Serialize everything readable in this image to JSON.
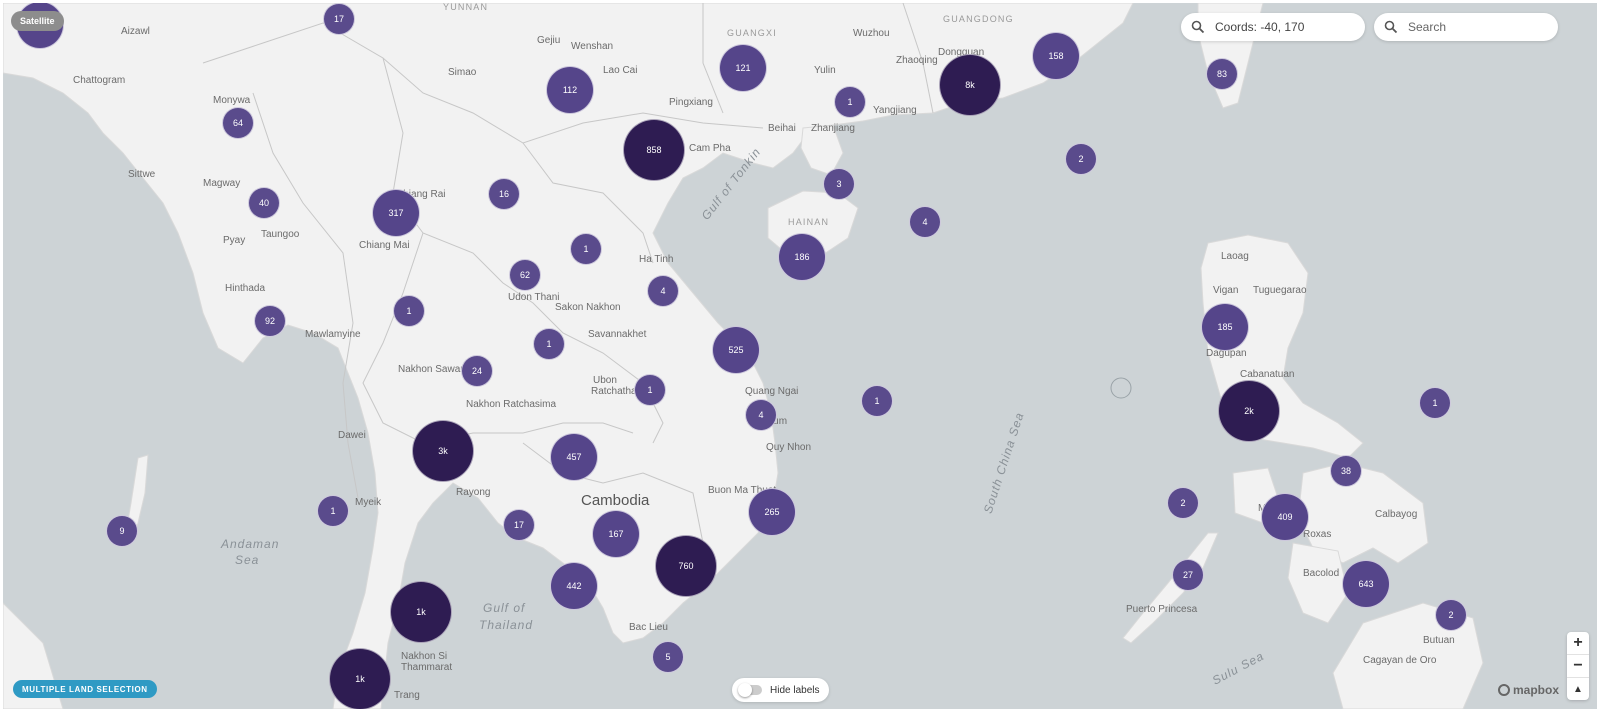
{
  "controls": {
    "satellite_label": "Satellite",
    "coords_value": "Coords: -40, 170",
    "search_placeholder": "Search",
    "multiple_land_label": "MULTIPLE LAND SELECTION",
    "hide_labels_label": "Hide labels",
    "zoom_in": "+",
    "zoom_out": "−",
    "compass": "▲",
    "attribution": "mapbox",
    "search_icon": "magnifier-icon"
  },
  "colors": {
    "water": "#cdd3d6",
    "land": "#f2f2f2",
    "cluster_small": "#5a4b8c",
    "cluster_big": "#2e1c52",
    "accent_button": "#2f9ac4"
  },
  "clusters": [
    {
      "label": "17"
    },
    {
      "label": "64"
    },
    {
      "label": "40"
    },
    {
      "label": "92"
    },
    {
      "label": "9"
    },
    {
      "label": "1"
    },
    {
      "label": "1"
    },
    {
      "label": "112"
    },
    {
      "label": "317"
    },
    {
      "label": "16"
    },
    {
      "label": "1"
    },
    {
      "label": "62"
    },
    {
      "label": "4"
    },
    {
      "label": "1"
    },
    {
      "label": "24"
    },
    {
      "label": "1"
    },
    {
      "label": "3k"
    },
    {
      "label": "457"
    },
    {
      "label": "17"
    },
    {
      "label": "167"
    },
    {
      "label": "442"
    },
    {
      "label": "1k"
    },
    {
      "label": "1k"
    },
    {
      "label": "5"
    },
    {
      "label": "760"
    },
    {
      "label": "265"
    },
    {
      "label": "4"
    },
    {
      "label": "525"
    },
    {
      "label": "858"
    },
    {
      "label": "121"
    },
    {
      "label": "1"
    },
    {
      "label": "3"
    },
    {
      "label": "186"
    },
    {
      "label": "4"
    },
    {
      "label": "8k"
    },
    {
      "label": "158"
    },
    {
      "label": "2"
    },
    {
      "label": "83"
    },
    {
      "label": "1"
    },
    {
      "label": "185"
    },
    {
      "label": "2k"
    },
    {
      "label": "1"
    },
    {
      "label": "38"
    },
    {
      "label": "2"
    },
    {
      "label": "409"
    },
    {
      "label": "27"
    },
    {
      "label": "643"
    },
    {
      "label": "2"
    }
  ],
  "place_labels": [
    "Aizawl",
    "Chattogram",
    "Monywa",
    "Sittwe",
    "Magway",
    "Pyay",
    "Taungoo",
    "Hinthada",
    "Mawlamyine",
    "Dawei",
    "Myeik",
    "Chiang Rai",
    "Chiang Mai",
    "Nakhon Sawan",
    "Nakhon Ratchasima",
    "Rayong",
    "Udon Thani",
    "Sakon Nakhon",
    "Savannakhet",
    "Ubon Ratchathani",
    "Ha Tinh",
    "Quang Ngai",
    "Kon Tum",
    "Quy Nhon",
    "Buon Ma Thuot",
    "Bac Lieu",
    "Nakhon Si Thammarat",
    "Trang",
    "Simao",
    "Gejiu",
    "Wenshan",
    "Lao Cai",
    "Pingxiang",
    "Cam Pha",
    "Yulin",
    "Beihai",
    "Zhanjiang",
    "Yangjiang",
    "Wuzhou",
    "Zhaoqing",
    "Dongguan",
    "Laoag",
    "Vigan",
    "Tuguegarao",
    "Dagupan",
    "Cabanatuan",
    "Mindoro",
    "Roxas",
    "Calbayog",
    "Bacolod",
    "Puerto Princesa",
    "Butuan",
    "Cagayan de Oro"
  ],
  "region_labels": [
    "YUNNAN",
    "GUANGXI",
    "GUANGDONG",
    "HAINAN"
  ],
  "sea_labels": [
    "Andaman Sea",
    "Gulf of Thailand",
    "Gulf of Tonkin",
    "South China Sea",
    "Sulu Sea"
  ],
  "country_labels": [
    "Cambodia"
  ]
}
